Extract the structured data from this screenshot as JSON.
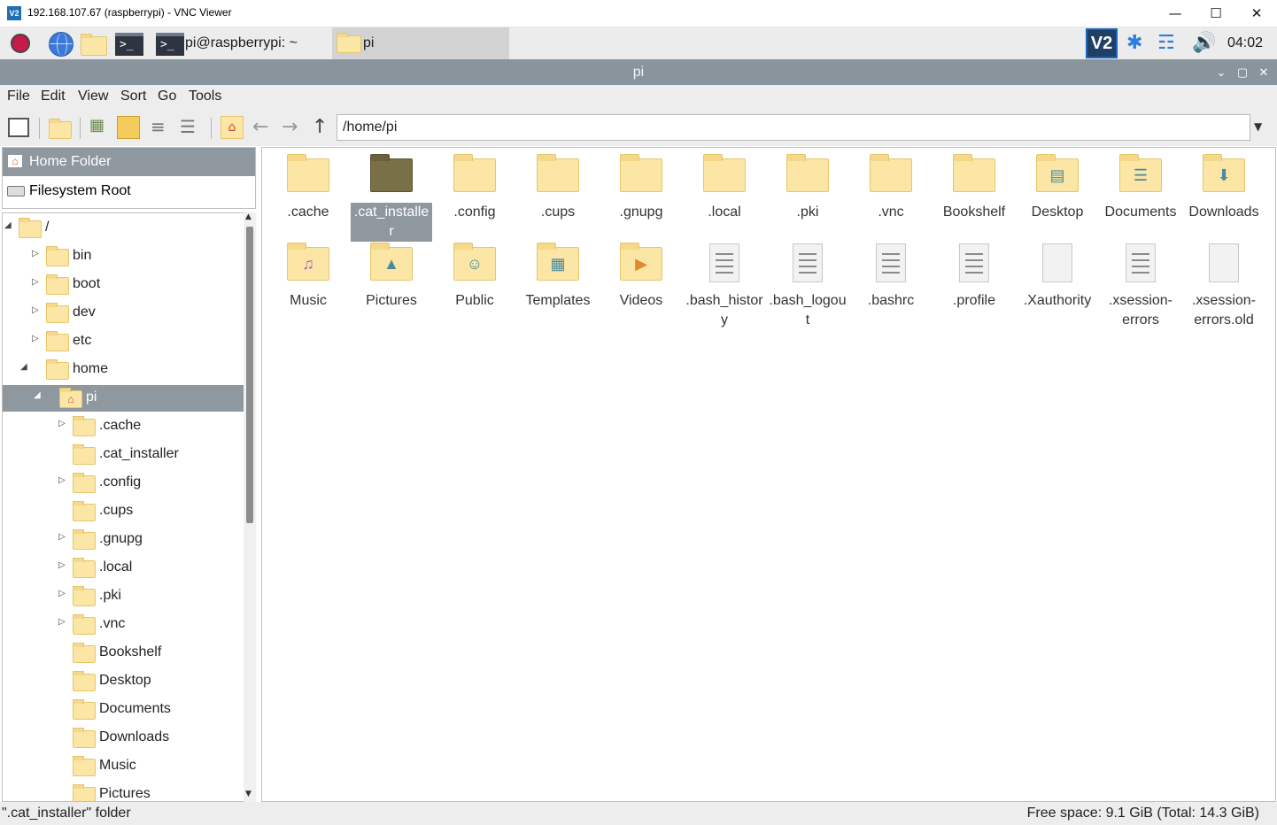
{
  "window": {
    "title": "192.168.107.67 (raspberrypi) - VNC Viewer",
    "app_icon": "V2"
  },
  "taskbar": {
    "terminal_task": "pi@raspberrypi: ~",
    "files_task": "pi",
    "vnc_tray": "V2",
    "clock": "04:02"
  },
  "fm": {
    "title": "pi"
  },
  "menu": [
    "File",
    "Edit",
    "View",
    "Sort",
    "Go",
    "Tools"
  ],
  "path": "/home/pi",
  "places": [
    {
      "label": "Home Folder",
      "selected": true,
      "icon": "home-icon"
    },
    {
      "label": "Filesystem Root",
      "selected": false,
      "icon": "drive-icon"
    }
  ],
  "tree": [
    {
      "label": "/",
      "depth": 0,
      "expanded": true
    },
    {
      "label": "bin",
      "depth": 1,
      "expander": true
    },
    {
      "label": "boot",
      "depth": 1,
      "expander": true
    },
    {
      "label": "dev",
      "depth": 1,
      "expander": true
    },
    {
      "label": "etc",
      "depth": 1,
      "expander": true
    },
    {
      "label": "home",
      "depth": 1,
      "expanded": true
    },
    {
      "label": "pi",
      "depth": 2,
      "expanded": true,
      "selected": true,
      "icon": "home"
    },
    {
      "label": ".cache",
      "depth": 3,
      "expander": true
    },
    {
      "label": ".cat_installer",
      "depth": 3
    },
    {
      "label": ".config",
      "depth": 3,
      "expander": true
    },
    {
      "label": ".cups",
      "depth": 3
    },
    {
      "label": ".gnupg",
      "depth": 3,
      "expander": true
    },
    {
      "label": ".local",
      "depth": 3,
      "expander": true
    },
    {
      "label": ".pki",
      "depth": 3,
      "expander": true
    },
    {
      "label": ".vnc",
      "depth": 3,
      "expander": true
    },
    {
      "label": "Bookshelf",
      "depth": 3
    },
    {
      "label": "Desktop",
      "depth": 3
    },
    {
      "label": "Documents",
      "depth": 3
    },
    {
      "label": "Downloads",
      "depth": 3
    },
    {
      "label": "Music",
      "depth": 3
    },
    {
      "label": "Pictures",
      "depth": 3
    }
  ],
  "items": [
    {
      "name": ".cache",
      "kind": "folder"
    },
    {
      "name": ".cat_installe\nr",
      "kind": "folder",
      "selected": true
    },
    {
      "name": ".config",
      "kind": "folder"
    },
    {
      "name": ".cups",
      "kind": "folder"
    },
    {
      "name": ".gnupg",
      "kind": "folder"
    },
    {
      "name": ".local",
      "kind": "folder"
    },
    {
      "name": ".pki",
      "kind": "folder"
    },
    {
      "name": ".vnc",
      "kind": "folder"
    },
    {
      "name": "Bookshelf",
      "kind": "folder"
    },
    {
      "name": "Desktop",
      "kind": "folder",
      "emblem": "desktop"
    },
    {
      "name": "Documents",
      "kind": "folder",
      "emblem": "documents"
    },
    {
      "name": "Downloads",
      "kind": "folder",
      "emblem": "downloads"
    },
    {
      "name": "Music",
      "kind": "folder",
      "emblem": "music"
    },
    {
      "name": "Pictures",
      "kind": "folder",
      "emblem": "pictures"
    },
    {
      "name": "Public",
      "kind": "folder",
      "emblem": "public"
    },
    {
      "name": "Templates",
      "kind": "folder",
      "emblem": "templates"
    },
    {
      "name": "Videos",
      "kind": "folder",
      "emblem": "videos"
    },
    {
      "name": ".bash_histor\ny",
      "kind": "text"
    },
    {
      "name": ".bash_logou\nt",
      "kind": "text"
    },
    {
      "name": ".bashrc",
      "kind": "text"
    },
    {
      "name": ".profile",
      "kind": "text"
    },
    {
      "name": ".Xauthority",
      "kind": "blank"
    },
    {
      "name": ".xsession-\nerrors",
      "kind": "text"
    },
    {
      "name": ".xsession-\nerrors.old",
      "kind": "blank"
    }
  ],
  "status": {
    "left": "\".cat_installer\" folder",
    "right": "Free space: 9.1 GiB (Total: 14.3 GiB)"
  },
  "colors": {
    "selection": "#8f979f",
    "folder": "#fbe6a6",
    "titlebar": "#8a949d"
  }
}
